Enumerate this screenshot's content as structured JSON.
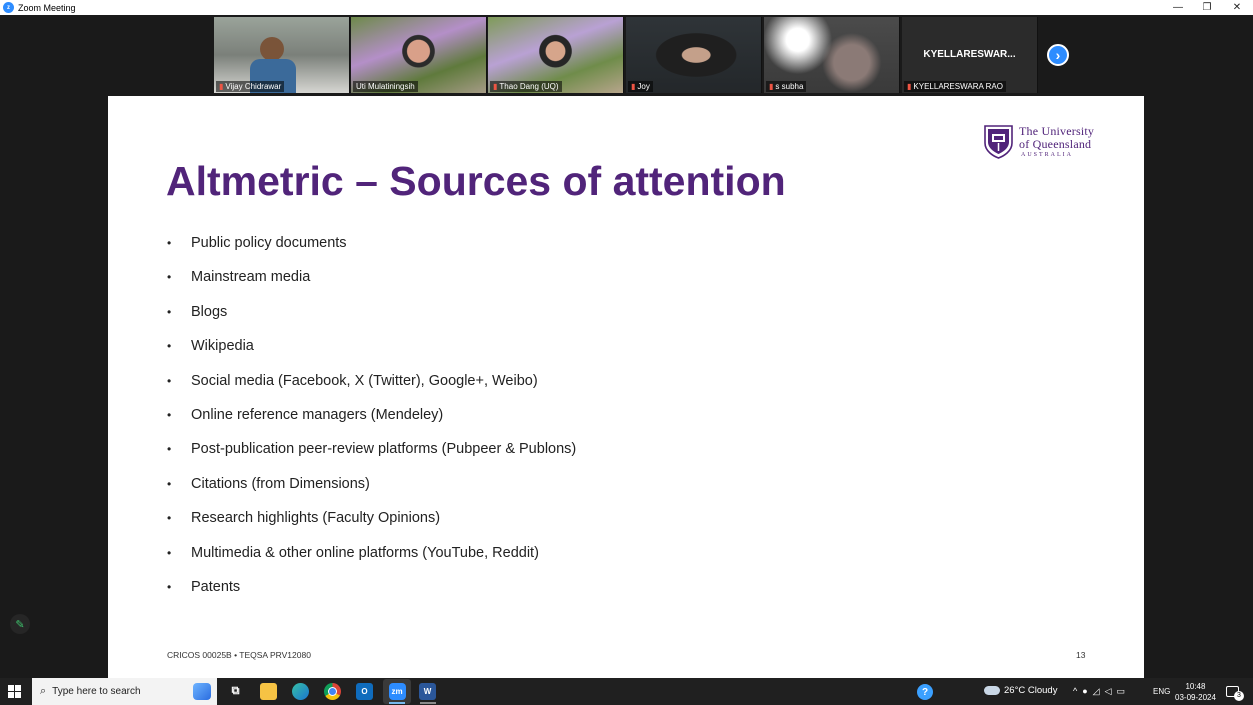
{
  "window": {
    "title": "Zoom Meeting",
    "minimize_glyph": "—",
    "maximize_glyph": "❐",
    "close_glyph": "✕"
  },
  "participants": [
    {
      "name": "Vijay Chidrawar"
    },
    {
      "name": "Uti Mulatiningsih"
    },
    {
      "name": "Thao Dang (UQ)"
    },
    {
      "name": "Joy"
    },
    {
      "name": "s subha"
    },
    {
      "name": "KYELLARESWARA RAO",
      "display_label": "KYELLARESWAR..."
    }
  ],
  "next_page_glyph": "›",
  "slide": {
    "title": "Altmetric – Sources of attention",
    "logo": {
      "line1": "The University",
      "line2": "of Queensland",
      "line3": "AUSTRALIA"
    },
    "bullet_glyph": "•",
    "bullets": [
      "Public policy documents",
      "Mainstream media",
      "Blogs",
      "Wikipedia",
      "Social media (Facebook,  X (Twitter), Google+, Weibo)",
      "Online reference managers (Mendeley)",
      "Post-publication peer-review platforms (Pubpeer & Publons)",
      "Citations (from Dimensions)",
      "Research highlights (Faculty Opinions)",
      "Multimedia & other online platforms (YouTube, Reddit)",
      "Patents"
    ],
    "footer": "CRICOS 00025B • TEQSA PRV12080",
    "page_number": "13"
  },
  "annotate_icon": "pencil-icon",
  "taskbar": {
    "search_placeholder": "Type here to search",
    "zoom_label": "zm",
    "word_label": "W",
    "outlook_label": "O",
    "weather": "26°C  Cloudy",
    "language": "ENG",
    "time": "10:48",
    "date": "03-09-2024",
    "notification_count": "3"
  },
  "colors": {
    "uq_purple": "#51247a",
    "zoom_blue": "#2d8cff"
  }
}
